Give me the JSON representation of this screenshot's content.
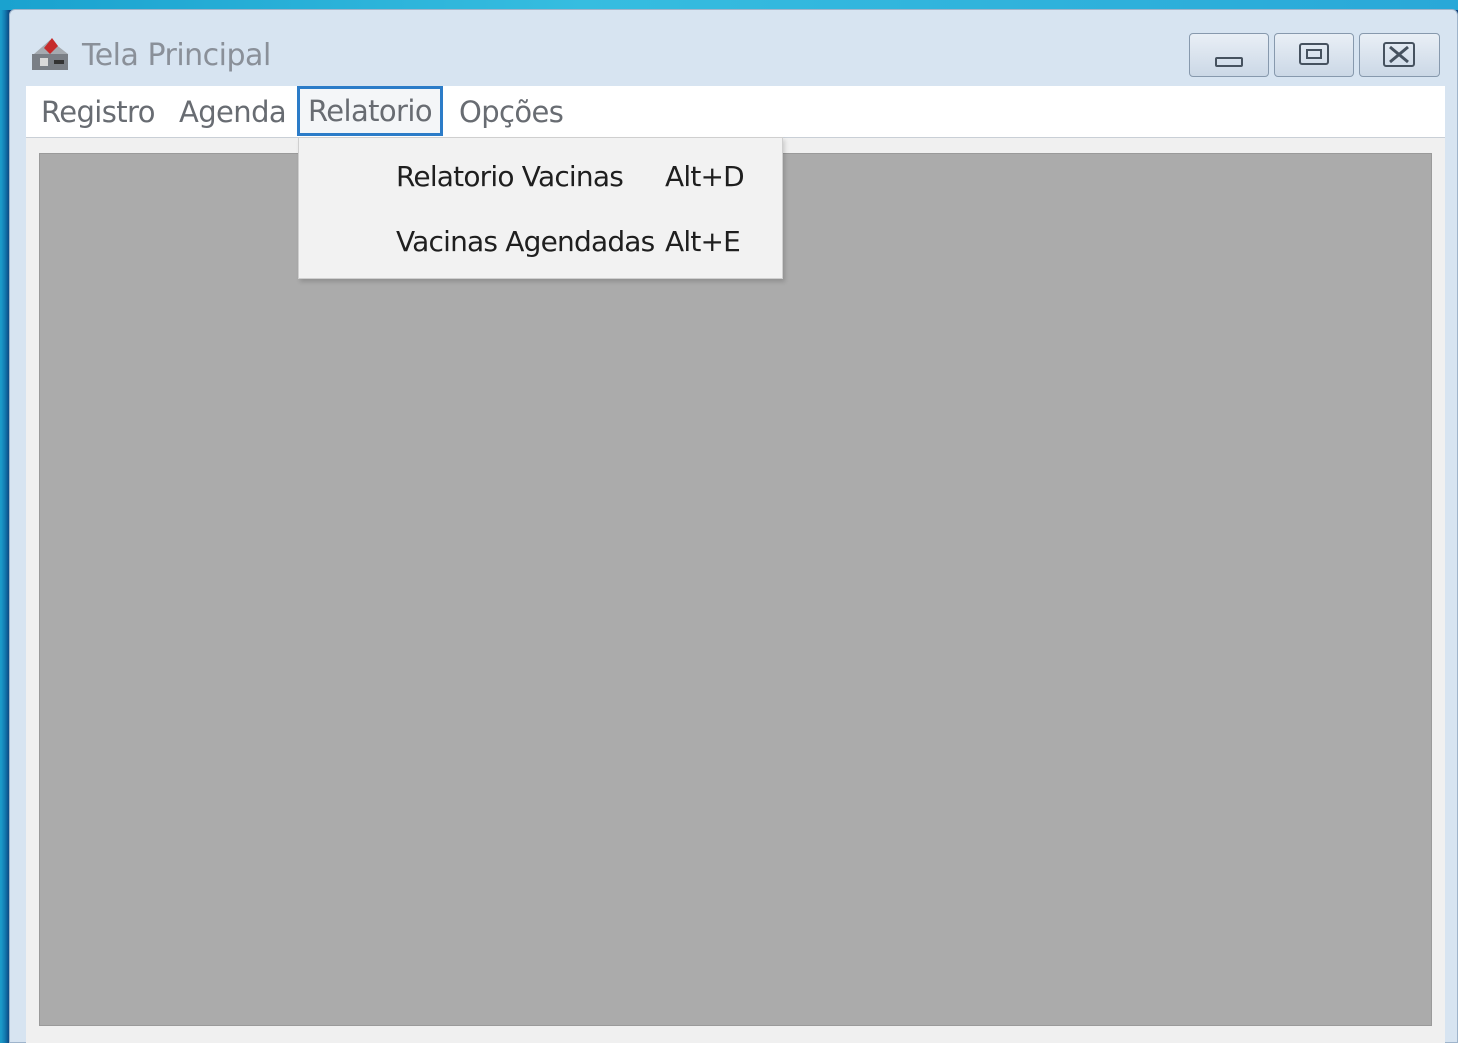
{
  "window": {
    "title": "Tela Principal"
  },
  "titlebar": {
    "icons": {
      "app": "app-icon",
      "minimize": "minimize-icon",
      "maximize": "maximize-icon",
      "close": "close-icon"
    }
  },
  "menubar": {
    "items": [
      {
        "label": "Registro"
      },
      {
        "label": "Agenda"
      },
      {
        "label": "Relatorio",
        "active": true
      },
      {
        "label": "Opções"
      }
    ]
  },
  "dropdown": {
    "items": [
      {
        "label": "Relatorio Vacinas",
        "accelerator": "Alt+D"
      },
      {
        "label": "Vacinas Agendadas",
        "accelerator": "Alt+E"
      }
    ]
  },
  "colors": {
    "active_menu_border": "#2c7cc8",
    "desktop_pane": "#ababab",
    "titlebar": "#d7e4f1"
  }
}
